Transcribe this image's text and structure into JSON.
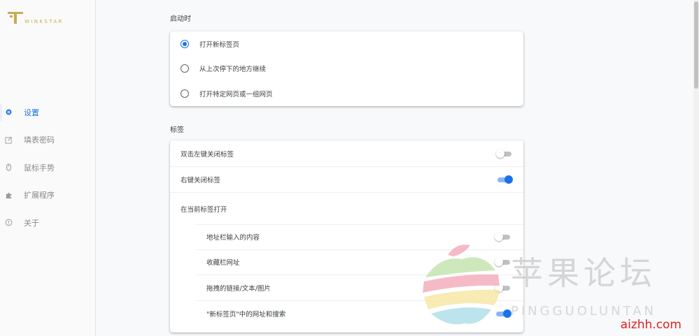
{
  "brand": {
    "name": "WINKSTAR",
    "accent": "#c8ab52"
  },
  "sidebar": {
    "items": [
      {
        "label": "设置",
        "icon": "gear-icon",
        "active": true
      },
      {
        "label": "填表密码",
        "icon": "form-edit-icon",
        "active": false
      },
      {
        "label": "鼠标手势",
        "icon": "mouse-icon",
        "active": false
      },
      {
        "label": "扩展程序",
        "icon": "puzzle-icon",
        "active": false
      },
      {
        "label": "关于",
        "icon": "info-icon",
        "active": false
      }
    ]
  },
  "startup": {
    "title": "启动时",
    "options": [
      {
        "label": "打开新标签页",
        "checked": true
      },
      {
        "label": "从上次停下的地方继续",
        "checked": false
      },
      {
        "label": "打开特定网页或一组网页",
        "checked": false
      }
    ]
  },
  "tabs": {
    "title": "标签",
    "close_double_click": {
      "label": "双击左键关闭标签",
      "on": false
    },
    "close_right_click": {
      "label": "右键关闭标签",
      "on": true
    },
    "open_in_current": {
      "label": "在当前标签打开",
      "items": [
        {
          "label": "地址栏输入的内容",
          "on": false
        },
        {
          "label": "收藏栏网址",
          "on": false
        },
        {
          "label": "拖拽的链接/文本/图片",
          "on": false
        },
        {
          "label": "\"新标签页\"中的网址和搜索",
          "on": true
        }
      ]
    }
  },
  "watermark": {
    "title": "苹果论坛",
    "subtitle": "PINGGUOLUNTAN",
    "domain": "aizhh.com"
  },
  "colors": {
    "accent": "#1a73e8",
    "toggle_on_track": "#8ab4f8",
    "toggle_off_track": "#bdc1c6"
  }
}
